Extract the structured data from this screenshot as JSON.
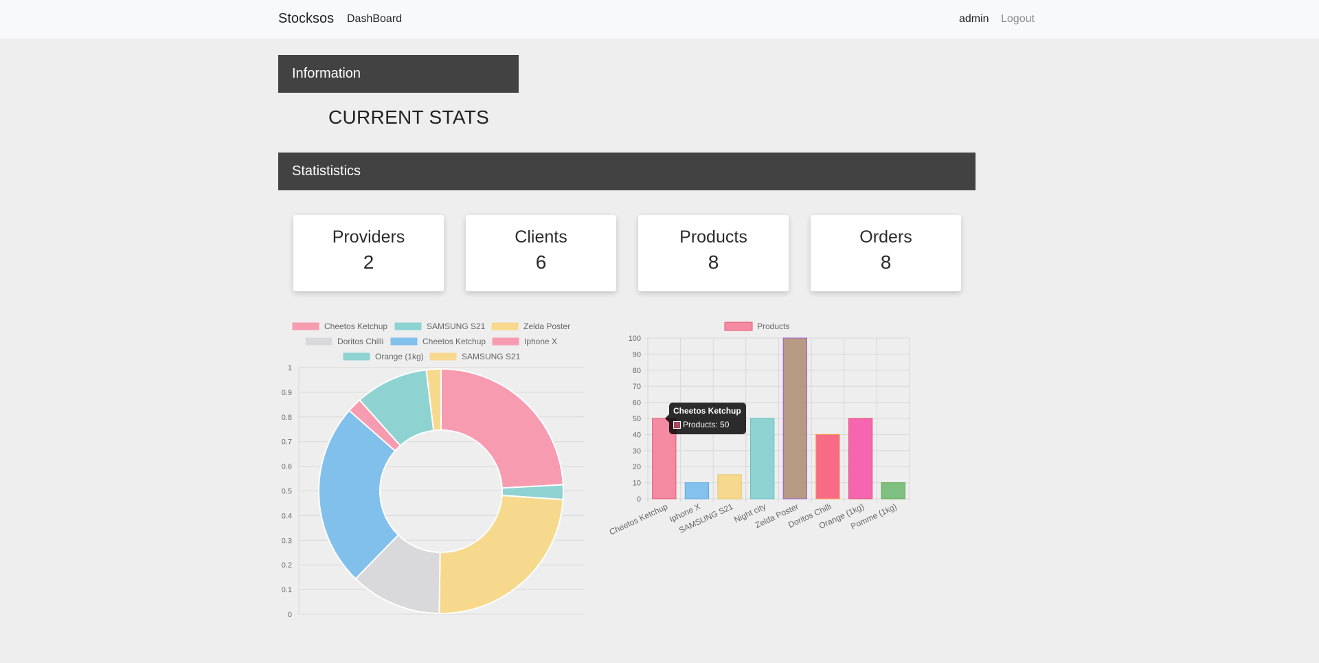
{
  "navbar": {
    "brand": "Stocksos",
    "dashboard": "DashBoard",
    "user": "admin",
    "logout": "Logout"
  },
  "info_panel": {
    "title": "Information"
  },
  "current_stats": "CURRENT STATS",
  "stats_panel": {
    "title": "Statististics"
  },
  "cards": [
    {
      "title": "Providers",
      "value": "2"
    },
    {
      "title": "Clients",
      "value": "6"
    },
    {
      "title": "Products",
      "value": "8"
    },
    {
      "title": "Orders",
      "value": "8"
    }
  ],
  "tooltip": {
    "title": "Cheetos Ketchup",
    "label": "Products: 50"
  },
  "chart_data": [
    {
      "type": "doughnut",
      "labels": [
        "Cheetos Ketchup",
        "SAMSUNG S21",
        "Zelda Poster",
        "Doritos Chilli",
        "Cheetos Ketchup",
        "Iphone X",
        "Orange (1kg)",
        "SAMSUNG S21"
      ],
      "values": [
        50,
        4,
        50,
        25,
        50,
        4,
        20,
        4
      ],
      "colors": [
        "#f79cb0",
        "#8ed3d2",
        "#f7d98e",
        "#d9d9db",
        "#82c0ec",
        "#f79cb0",
        "#8ed3d2",
        "#f7d98e"
      ],
      "legend_position": "top",
      "y_ticks": [
        "0",
        "0.1",
        "0.2",
        "0.3",
        "0.4",
        "0.5",
        "0.6",
        "0.7",
        "0.8",
        "0.9",
        "1"
      ],
      "grid": true
    },
    {
      "type": "bar",
      "legend": "Products",
      "categories": [
        "Cheetos Ketchup",
        "Iphone X",
        "SAMSUNG S21",
        "Night city",
        "Zelda Poster",
        "Doritos Chilli",
        "Orange (1kg)",
        "Pomme (1kg)"
      ],
      "values": [
        50,
        10,
        15,
        50,
        100,
        40,
        50,
        10
      ],
      "colors": [
        "#f58aa3",
        "#84c1ed",
        "#f7d98e",
        "#8ed3d2",
        "#b79a83",
        "#f76b87",
        "#f565b0",
        "#7fbf7f"
      ],
      "border_colors": [
        "#e5546f",
        "#5aa9e6",
        "#e8c26b",
        "#5fbfbe",
        "#9b59d0",
        "#f49a4a",
        "#e5546f",
        "#5aa950"
      ],
      "ylim": [
        0,
        100
      ],
      "y_ticks": [
        "0",
        "10",
        "20",
        "30",
        "40",
        "50",
        "60",
        "70",
        "80",
        "90",
        "100"
      ],
      "grid": true
    }
  ]
}
